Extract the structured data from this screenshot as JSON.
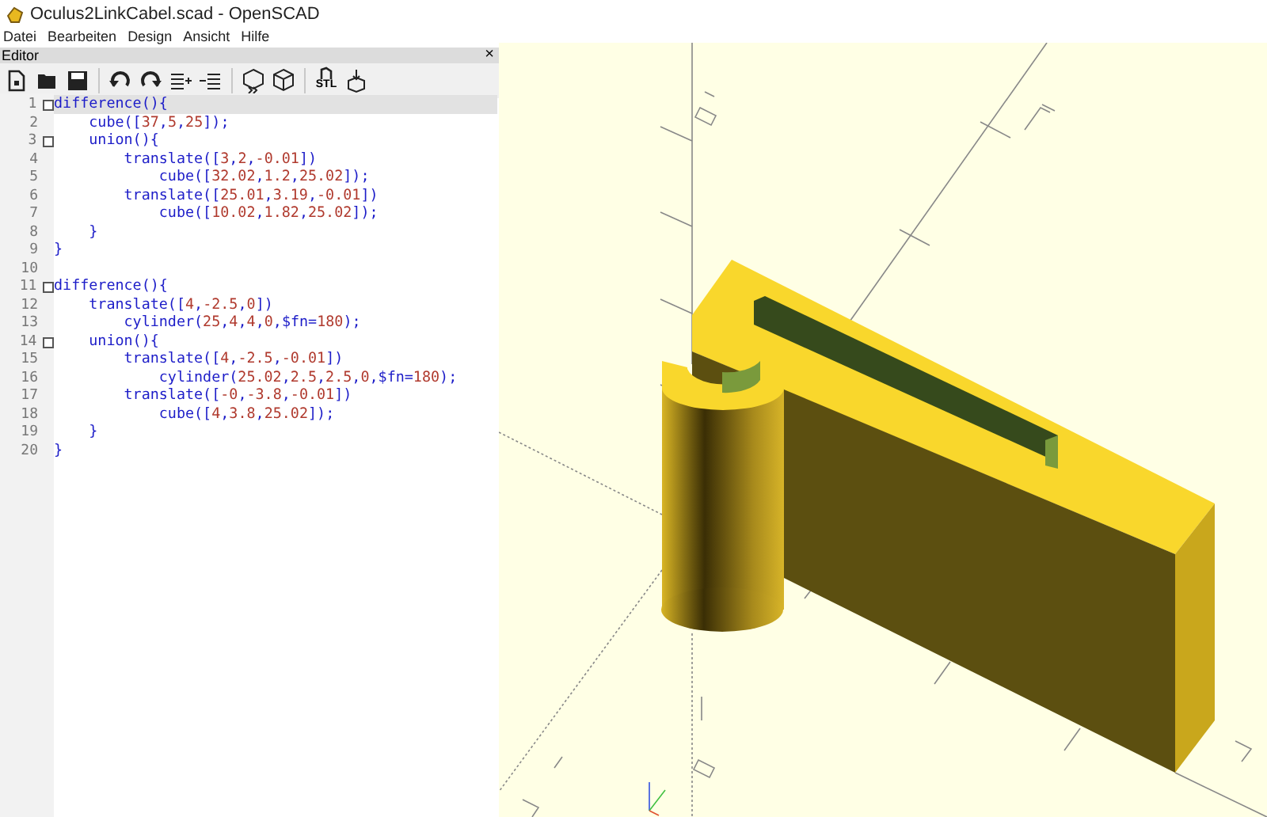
{
  "window": {
    "title": "Oculus2LinkCabel.scad - OpenSCAD"
  },
  "menu": [
    "Datei",
    "Bearbeiten",
    "Design",
    "Ansicht",
    "Hilfe"
  ],
  "editor_panel": {
    "title": "Editor",
    "close": "×"
  },
  "toolbar": [
    {
      "kind": "new"
    },
    {
      "kind": "open"
    },
    {
      "kind": "save"
    },
    {
      "kind": "sep"
    },
    {
      "kind": "undo"
    },
    {
      "kind": "redo"
    },
    {
      "kind": "indent"
    },
    {
      "kind": "unindent"
    },
    {
      "kind": "sep"
    },
    {
      "kind": "preview"
    },
    {
      "kind": "render"
    },
    {
      "kind": "sep"
    },
    {
      "kind": "stl",
      "label": "STL"
    },
    {
      "kind": "export3d"
    }
  ],
  "code_lines": [
    {
      "number": "1",
      "text": "difference(){",
      "fold": true,
      "selected": true
    },
    {
      "number": "2",
      "text": "    cube([37,5,25]);",
      "fold": false,
      "selected": false
    },
    {
      "number": "3",
      "text": "    union(){",
      "fold": true,
      "selected": false
    },
    {
      "number": "4",
      "text": "        translate([3,2,-0.01])",
      "fold": false,
      "selected": false
    },
    {
      "number": "5",
      "text": "            cube([32.02,1.2,25.02]);",
      "fold": false,
      "selected": false
    },
    {
      "number": "6",
      "text": "        translate([25.01,3.19,-0.01])",
      "fold": false,
      "selected": false
    },
    {
      "number": "7",
      "text": "            cube([10.02,1.82,25.02]);",
      "fold": false,
      "selected": false
    },
    {
      "number": "8",
      "text": "    }",
      "fold": false,
      "selected": false
    },
    {
      "number": "9",
      "text": "}",
      "fold": false,
      "selected": false
    },
    {
      "number": "10",
      "fold": false,
      "selected": false
    },
    {
      "number": "11",
      "text": "difference(){",
      "fold": true,
      "selected": false
    },
    {
      "number": "12",
      "text": "    translate([4,-2.5,0])",
      "fold": false,
      "selected": false
    },
    {
      "number": "13",
      "text": "        cylinder(25,4,4,0,$fn=180);",
      "fold": false,
      "selected": false
    },
    {
      "number": "14",
      "text": "    union(){",
      "fold": true,
      "selected": false
    },
    {
      "number": "15",
      "text": "        translate([4,-2.5,-0.01])",
      "fold": false,
      "selected": false
    },
    {
      "number": "16",
      "text": "            cylinder(25.02,2.5,2.5,0,$fn=180);",
      "fold": false,
      "selected": false
    },
    {
      "number": "17",
      "text": "        translate([-0,-3.8,-0.01])",
      "fold": false,
      "selected": false
    },
    {
      "number": "18",
      "text": "            cube([4,3.8,25.02]);",
      "fold": false,
      "selected": false
    },
    {
      "number": "19",
      "text": "    }",
      "fold": false,
      "selected": false
    },
    {
      "number": "20",
      "text": "}",
      "fold": false,
      "selected": false
    }
  ]
}
